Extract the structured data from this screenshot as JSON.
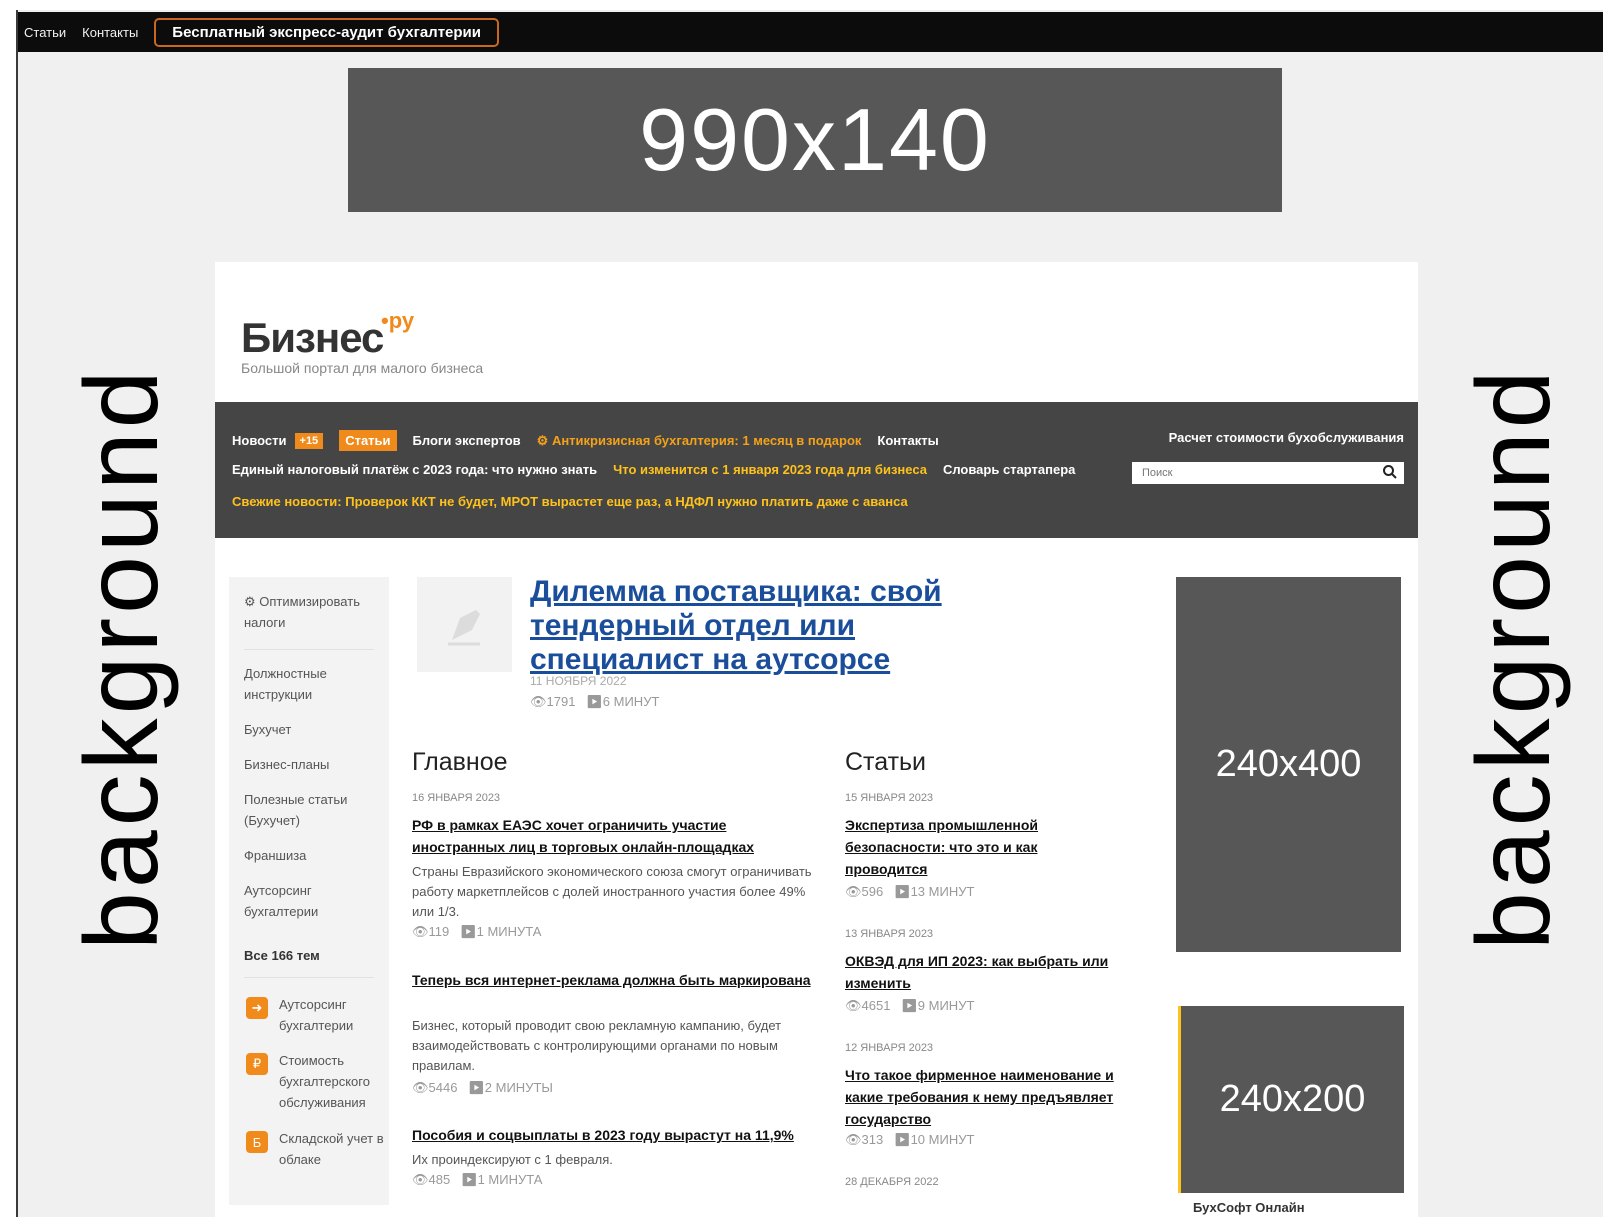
{
  "topbar": {
    "links": [
      "Статьи",
      "Контакты"
    ],
    "cta": "Бесплатный экспресс-аудит бухгалтерии"
  },
  "ads": {
    "top": "990x140",
    "side_large": "240x400",
    "side_small": "240x200",
    "side_small_caption": "БухСофт Онлайн"
  },
  "background_label": "background",
  "logo": {
    "title": "Бизнес",
    "sup": "•ру",
    "subtitle": "Большой портал для малого бизнеса"
  },
  "nav": {
    "row1": {
      "news": "Новости",
      "news_badge": "+15",
      "articles": "Статьи",
      "blogs": "Блоги экспертов",
      "promo": "Антикризисная бухгалтерия: 1 месяц в подарок",
      "contacts": "Контакты"
    },
    "right": "Расчет стоимости бухобслуживания",
    "row2": {
      "item1": "Единый налоговый платёж с 2023 года: что нужно знать",
      "item2": "Что изменится с 1 января 2023 года для бизнеса",
      "item3": "Словарь стартапера"
    },
    "row3": "Свежие новости: Проверок ККТ не будет, МРОТ вырастет еще раз, а НДФЛ нужно платить даже с аванса",
    "search_placeholder": "Поиск"
  },
  "sidebar": {
    "optimize": "Оптимизировать налоги",
    "items": [
      "Должностные инструкции",
      "Бухучет",
      "Бизнес-планы",
      "Полезные статьи (Бухучет)",
      "Франшиза",
      "Аутсорсинг бухгалтерии"
    ],
    "all_topics": "Все 166 тем",
    "promos": [
      "Аутсорсинг бухгалтерии",
      "Стоимость бухгалтерского обслуживания",
      "Складской учет в облаке"
    ],
    "promo_icon_letter": "Б"
  },
  "feature": {
    "title": "Дилемма поставщика: свой тендерный отдел или специалист на аутсорсе",
    "date": "11 НОЯБРЯ 2022",
    "views": "1791",
    "read_time": "6 МИНУТ"
  },
  "main": {
    "heading": "Главное",
    "items": [
      {
        "date": "16 января 2023",
        "title": "РФ в рамках ЕАЭС хочет ограничить участие иностранных лиц в торговых онлайн-площадках",
        "excerpt": "Страны Евразийского экономического союза смогут ограничивать работу маркетплейсов с долей иностранного участия более 49% или 1/3.",
        "views": "119",
        "read_time": "1 МИНУТА"
      },
      {
        "date": "",
        "title": "Теперь вся интернет-реклама должна быть маркирована",
        "excerpt": "Бизнес, который проводит свою рекламную кампанию, будет взаимодействовать с контролирующими органами по новым правилам.",
        "views": "5446",
        "read_time": "2 МИНУТЫ"
      },
      {
        "date": "",
        "title": "Пособия и соцвыплаты в 2023 году вырастут на 11,9%",
        "excerpt": "Их проиндексируют с 1 февраля.",
        "views": "485",
        "read_time": "1 МИНУТА"
      }
    ]
  },
  "articles": {
    "heading": "Статьи",
    "items": [
      {
        "date": "15 января 2023",
        "title": "Экспертиза промышленной безопасности: что это и как проводится",
        "views": "596",
        "read_time": "13 МИНУТ"
      },
      {
        "date": "13 января 2023",
        "title": "ОКВЭД для ИП 2023: как выбрать или изменить",
        "views": "4651",
        "read_time": "9 МИНУТ"
      },
      {
        "date": "12 января 2023",
        "title": "Что такое фирменное наименование и какие требования к нему предъявляет государство",
        "views": "313",
        "read_time": "10 МИНУТ"
      },
      {
        "date": "28 декабря 2022",
        "title": "",
        "views": "",
        "read_time": ""
      }
    ]
  }
}
